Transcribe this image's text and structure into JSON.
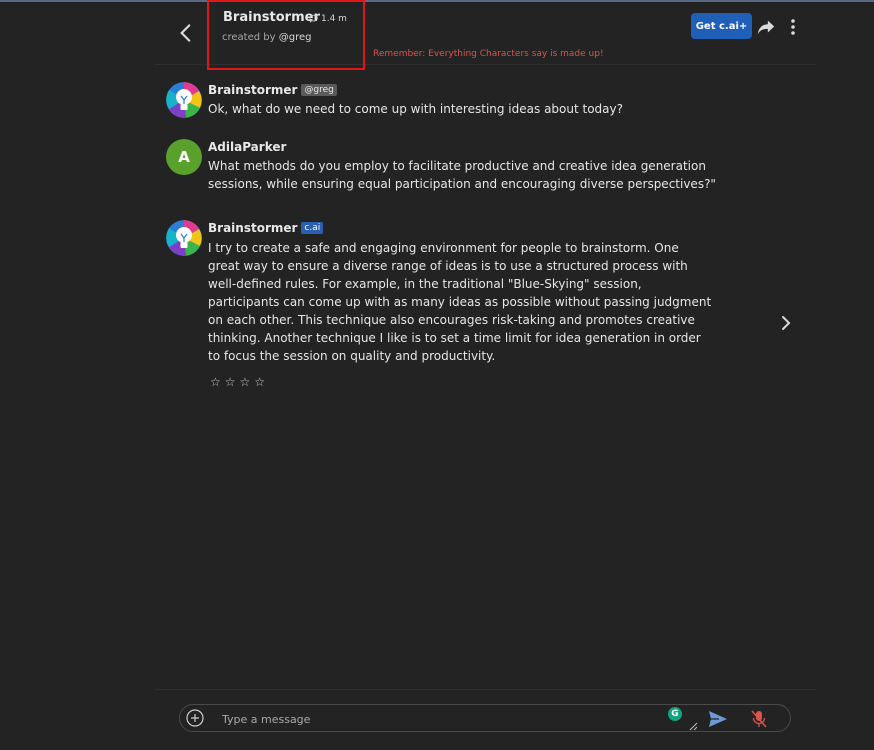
{
  "header": {
    "title": "Brainstormer",
    "chat_count": "1.4 m",
    "creator_prefix": "created by",
    "creator_handle": "@greg",
    "disclaimer": "Remember: Everything Characters say is made up!",
    "upgrade_label": "Get c.ai+"
  },
  "messages": [
    {
      "name": "Brainstormer",
      "badge": "@greg",
      "lines": [
        "Ok, what do we need to come up with interesting ideas about today?"
      ]
    },
    {
      "name": "AdilaParker",
      "avatar_letter": "A",
      "lines": [
        "What methods do you employ to facilitate productive and creative idea generation",
        "sessions, while ensuring equal participation and encouraging diverse perspectives?\""
      ]
    },
    {
      "name": "Brainstormer",
      "badge": "c.ai",
      "lines": [
        "I try to create a safe and engaging environment for people to brainstorm.  One",
        "great way to ensure a diverse range of ideas is to use a structured process with",
        "well-defined rules.  For example, in the traditional \"Blue-Skying\" session,",
        "participants can come up with as many ideas as possible without passing judgment",
        "on each other.  This technique also encourages risk-taking and promotes creative",
        "thinking.  Another technique I like is to set a time limit for idea generation in order",
        "to focus the session on quality and productivity."
      ],
      "rating_stars": 4
    }
  ],
  "composer": {
    "placeholder": "Type a message",
    "grammarly_letter": "G"
  },
  "colors": {
    "background": "#232323",
    "accent_button": "#1f5fb8",
    "disclaimer": "#d9534f",
    "highlight_box": "#e0161a",
    "user_avatar": "#5aa02c",
    "cai_badge": "#2c5fb0"
  },
  "icons": {
    "back": "chevron-left-icon",
    "share": "share-arrow-icon",
    "more": "vertical-dots-icon",
    "next": "chevron-right-icon",
    "add": "plus-circle-icon",
    "send": "send-icon",
    "mic": "mic-off-icon",
    "star": "star-outline-icon"
  }
}
